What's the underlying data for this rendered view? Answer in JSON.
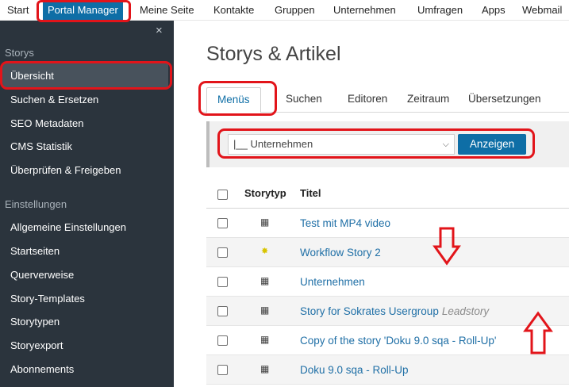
{
  "topnav": {
    "items": [
      "Start",
      "Portal Manager",
      "Meine Seite",
      "Kontakte",
      "Gruppen",
      "Unternehmen",
      "Umfragen",
      "Apps",
      "Webmail"
    ]
  },
  "sidebar": {
    "close": "×",
    "section_storys": "Storys",
    "storys_items": [
      "Übersicht",
      "Suchen & Ersetzen",
      "SEO Metadaten",
      "CMS Statistik",
      "Überprüfen & Freigeben"
    ],
    "section_settings": "Einstellungen",
    "settings_items": [
      "Allgemeine Einstellungen",
      "Startseiten",
      "Querverweise",
      "Story-Templates",
      "Storytypen",
      "Storyexport",
      "Abonnements"
    ]
  },
  "main": {
    "title": "Storys & Artikel",
    "tabs": [
      "Menüs",
      "Suchen",
      "Editoren",
      "Zeitraum",
      "Übersetzungen"
    ],
    "filter": {
      "selected": "|__ Unternehmen",
      "button": "Anzeigen"
    },
    "table": {
      "headers": [
        "Storytyp",
        "Titel"
      ],
      "rows": [
        {
          "icon": "article-icon",
          "title": "Test mit MP4 video",
          "tag": ""
        },
        {
          "icon": "star-icon",
          "title": "Workflow Story 2",
          "tag": ""
        },
        {
          "icon": "article-icon",
          "title": "Unternehmen",
          "tag": ""
        },
        {
          "icon": "article-icon",
          "title": "Story for Sokrates Usergroup",
          "tag": "Leadstory"
        },
        {
          "icon": "article-icon",
          "title": "Copy of the story 'Doku 9.0 sqa - Roll-Up'",
          "tag": ""
        },
        {
          "icon": "article-icon",
          "title": "Doku 9.0 sqa - Roll-Up",
          "tag": ""
        }
      ]
    }
  },
  "colors": {
    "accent": "#0e6ea6",
    "sidebar": "#2b343d",
    "annotation": "#e2141a"
  }
}
